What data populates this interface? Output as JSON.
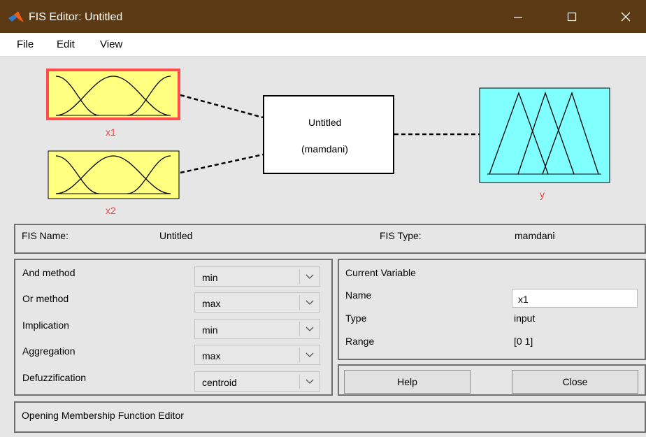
{
  "window": {
    "title": "FIS Editor: Untitled",
    "app_icon": "matlab-icon",
    "titlebar_color": "#5b3a13"
  },
  "menu": [
    "File",
    "Edit",
    "View"
  ],
  "diagram": {
    "input1": {
      "label": "x1",
      "selected": true,
      "color": "#ffff80"
    },
    "input2": {
      "label": "x2",
      "color": "#ffff80"
    },
    "system": {
      "name": "Untitled",
      "type": "(mamdani)"
    },
    "output": {
      "label": "y",
      "color": "#80ffff"
    },
    "label_color": "#ff4040",
    "selection_color": "#ff4d4d"
  },
  "fis": {
    "name_label": "FIS Name:",
    "name_value": "Untitled",
    "type_label": "FIS Type:",
    "type_value": "mamdani"
  },
  "methods": [
    {
      "label": "And method",
      "value": "min"
    },
    {
      "label": "Or method",
      "value": "max"
    },
    {
      "label": "Implication",
      "value": "min"
    },
    {
      "label": "Aggregation",
      "value": "max"
    },
    {
      "label": "Defuzzification",
      "value": "centroid"
    }
  ],
  "current_variable": {
    "header": "Current Variable",
    "name_label": "Name",
    "name_value": "x1",
    "type_label": "Type",
    "type_value": "input",
    "range_label": "Range",
    "range_value": "[0 1]"
  },
  "buttons": {
    "help": "Help",
    "close": "Close"
  },
  "status": "Opening Membership Function Editor"
}
